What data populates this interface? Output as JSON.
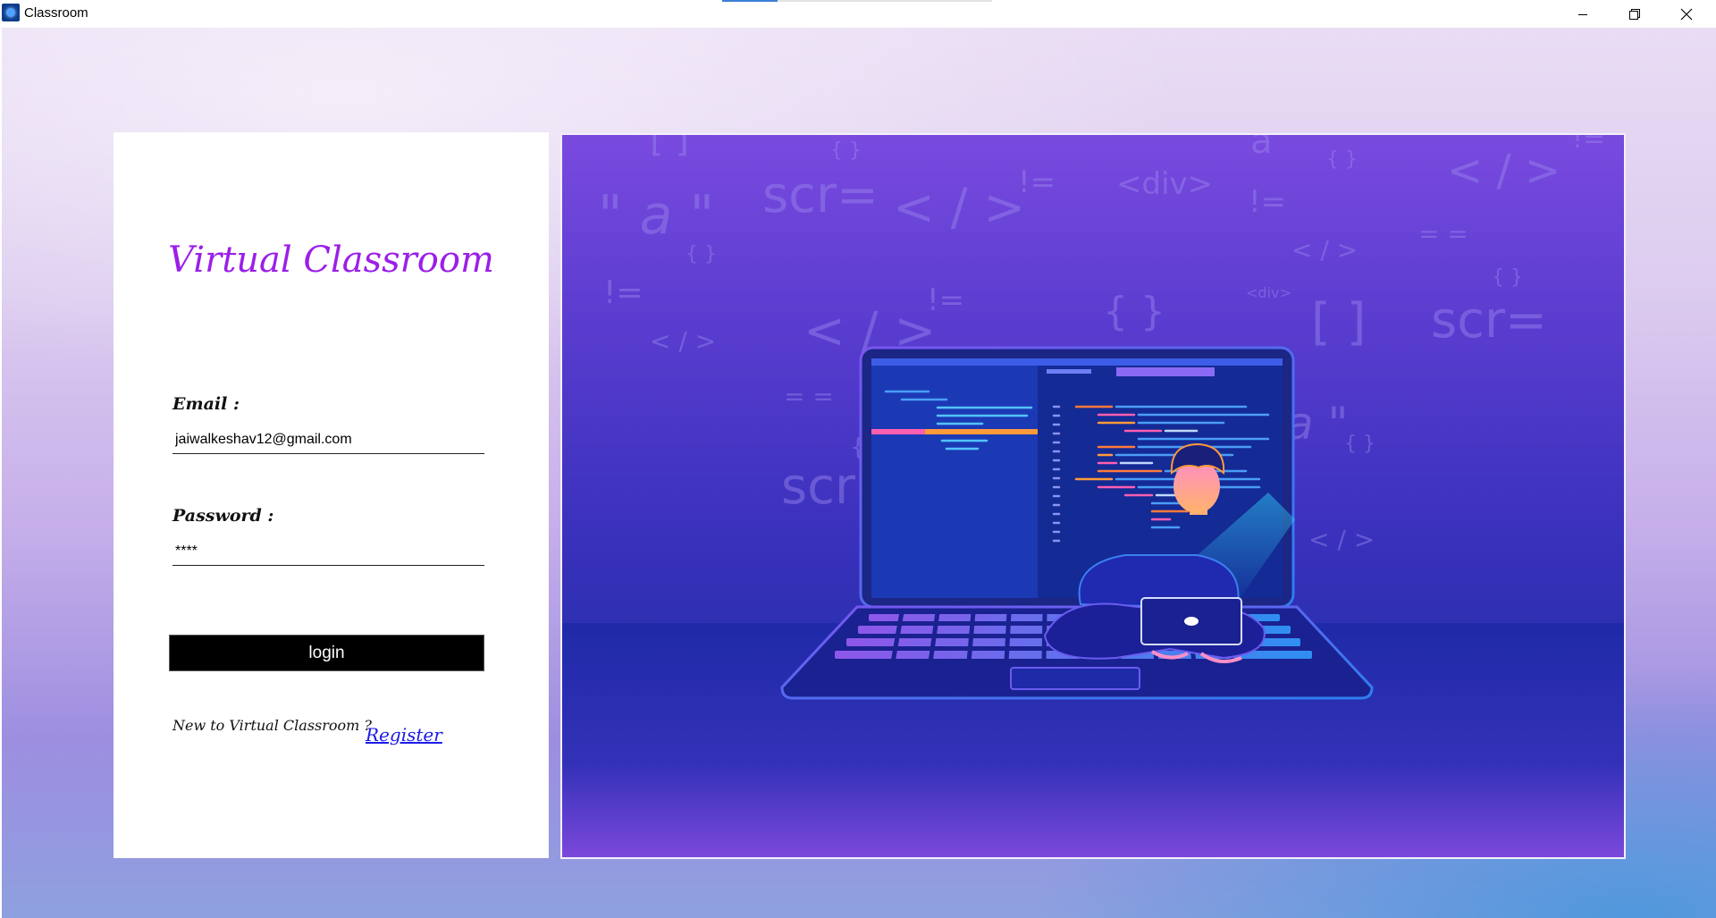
{
  "window": {
    "title": "Classroom",
    "controls": {
      "minimize_icon": "minimize-icon",
      "restore_icon": "restore-icon",
      "close_icon": "close-icon"
    }
  },
  "login_card": {
    "heading": "Virtual Classroom",
    "email_label": "Email :",
    "email_value": "jaiwalkeshav12@gmail.com",
    "password_label": "Password :",
    "password_value": "****",
    "login_button": "login",
    "footer_text": "New to Virtual Classroom ?",
    "register_link": "Register"
  },
  "illustration": {
    "subject": "person-with-laptop-illustration",
    "background_tokens": [
      "[ ]",
      "{ }",
      "{ }",
      "a",
      "{ }",
      "!=",
      "\" a \"",
      "scr=",
      "< / >",
      "!=",
      "<div>",
      "!=",
      "< / >",
      "{ }",
      "< / >",
      "= =",
      "!=",
      "{ }",
      "< / >",
      "!=",
      "<div>",
      "< / >",
      "{ }",
      "[ ]",
      "scr=",
      "= =",
      "{",
      "a \"",
      "{ }",
      "scr",
      "< / >"
    ]
  },
  "colors": {
    "accent_purple": "#9b1fe8",
    "link_blue": "#1a1ae6",
    "button_black": "#000000"
  }
}
